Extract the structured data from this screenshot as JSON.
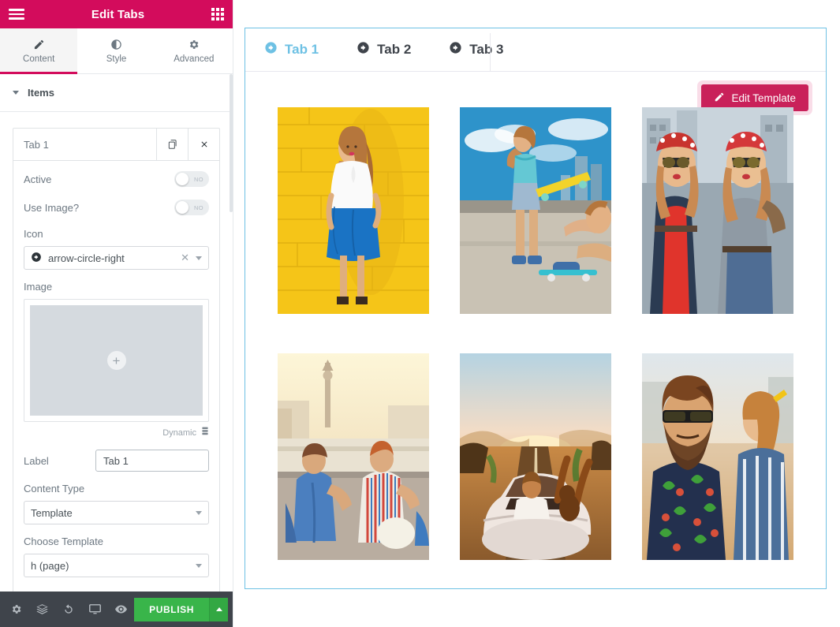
{
  "panel": {
    "header": {
      "title": "Edit Tabs",
      "menu_icon": "hamburger-icon",
      "apps_icon": "grid-icon"
    },
    "tabs": [
      {
        "label": "Content",
        "icon": "pencil-icon",
        "active": true
      },
      {
        "label": "Style",
        "icon": "contrast-icon",
        "active": false
      },
      {
        "label": "Advanced",
        "icon": "gear-icon",
        "active": false
      }
    ],
    "section": {
      "title": "Items",
      "caret_icon": "chevron-down-icon"
    },
    "item": {
      "name": "Tab 1",
      "duplicate_icon": "duplicate-icon",
      "remove_icon": "close-icon",
      "controls": {
        "active": {
          "label": "Active",
          "value": "NO"
        },
        "use_image": {
          "label": "Use Image?",
          "value": "NO"
        },
        "icon": {
          "label": "Icon",
          "value": "arrow-circle-right",
          "clear_icon": "clear-x-icon",
          "caret_icon": "chevron-down-icon"
        },
        "image": {
          "label": "Image",
          "add_icon": "plus-circle-icon",
          "dynamic_label": "Dynamic",
          "dynamic_icon": "database-icon"
        },
        "label": {
          "label": "Label",
          "value": "Tab 1"
        },
        "content_type": {
          "label": "Content Type",
          "value": "Template",
          "caret_icon": "chevron-down-icon"
        },
        "choose_template": {
          "label": "Choose Template",
          "value": "h (page)",
          "caret_icon": "chevron-down-icon"
        }
      }
    },
    "footer": {
      "settings_icon": "gear-icon",
      "navigator_icon": "layers-icon",
      "history_icon": "history-icon",
      "responsive_icon": "monitor-icon",
      "preview_icon": "eye-icon",
      "publish_label": "PUBLISH",
      "publish_caret_icon": "chevron-up-icon"
    }
  },
  "canvas": {
    "tabs": [
      {
        "label": "Tab 1",
        "icon": "arrow-circle-right-icon",
        "active": true
      },
      {
        "label": "Tab 2",
        "icon": "arrow-circle-right-icon",
        "active": false
      },
      {
        "label": "Tab 3",
        "icon": "arrow-circle-right-icon",
        "active": false
      }
    ],
    "edit_template": {
      "label": "Edit Template",
      "icon": "pencil-icon"
    },
    "gallery": [
      {
        "alt": "woman-in-white-blouse-against-yellow-brick-wall"
      },
      {
        "alt": "young-women-with-skateboards-on-city-plaza"
      },
      {
        "alt": "two-women-in-sunglasses-and-bandanas"
      },
      {
        "alt": "couple-sitting-on-river-embankment"
      },
      {
        "alt": "friends-in-convertible-car-at-sunset"
      },
      {
        "alt": "bearded-man-in-sunglasses-with-friends"
      }
    ]
  },
  "colors": {
    "brand": "#d30c5c",
    "accent_blue": "#6ec1e4",
    "publish_green": "#39b54a",
    "footer_dark": "#3f444b"
  }
}
